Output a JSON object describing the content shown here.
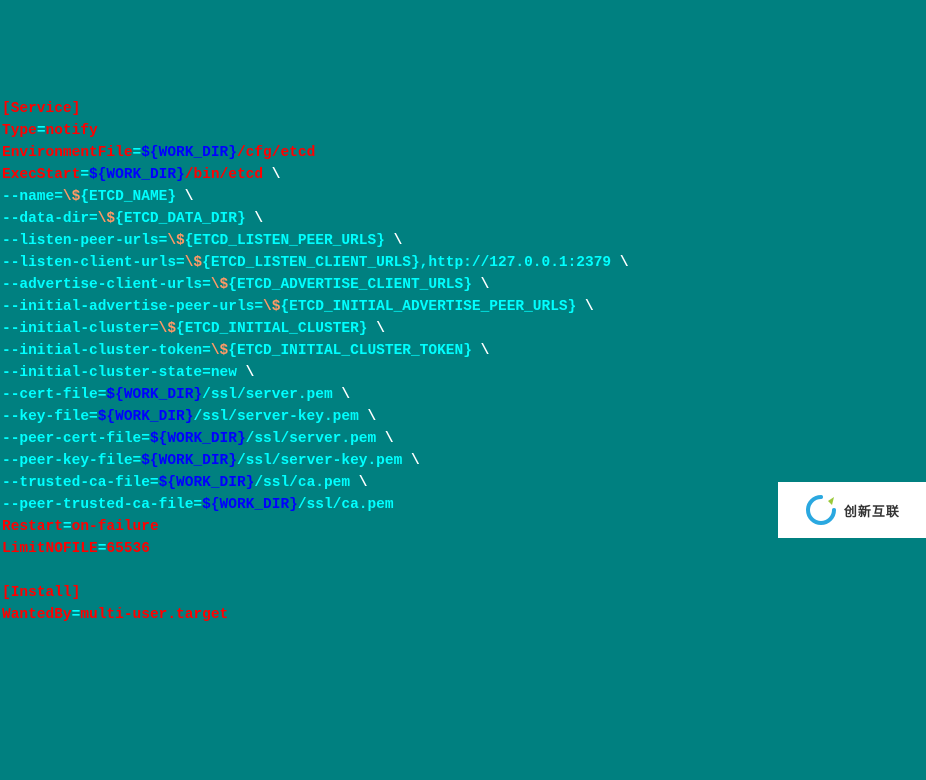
{
  "lines": [
    [
      {
        "cls": "c-red",
        "t": "[Service]"
      }
    ],
    [
      {
        "cls": "c-red",
        "t": "Type"
      },
      {
        "cls": "c-teal",
        "t": "="
      },
      {
        "cls": "c-red",
        "t": "notify"
      }
    ],
    [
      {
        "cls": "c-red",
        "t": "EnvironmentFile"
      },
      {
        "cls": "c-teal",
        "t": "="
      },
      {
        "cls": "c-blue",
        "t": "${WORK_DIR}"
      },
      {
        "cls": "c-red",
        "t": "/cfg/etcd"
      }
    ],
    [
      {
        "cls": "c-red",
        "t": "ExecStart"
      },
      {
        "cls": "c-teal",
        "t": "="
      },
      {
        "cls": "c-blue",
        "t": "${WORK_DIR}"
      },
      {
        "cls": "c-red",
        "t": "/bin/etcd "
      },
      {
        "cls": "c-white",
        "t": "\\"
      }
    ],
    [
      {
        "cls": "c-teal",
        "t": "--name="
      },
      {
        "cls": "c-peach",
        "t": "\\$"
      },
      {
        "cls": "c-teal",
        "t": "{ETCD_NAME} "
      },
      {
        "cls": "c-white",
        "t": "\\"
      }
    ],
    [
      {
        "cls": "c-teal",
        "t": "--data-dir="
      },
      {
        "cls": "c-peach",
        "t": "\\$"
      },
      {
        "cls": "c-teal",
        "t": "{ETCD_DATA_DIR} "
      },
      {
        "cls": "c-white",
        "t": "\\"
      }
    ],
    [
      {
        "cls": "c-teal",
        "t": "--listen-peer-urls="
      },
      {
        "cls": "c-peach",
        "t": "\\$"
      },
      {
        "cls": "c-teal",
        "t": "{ETCD_LISTEN_PEER_URLS} "
      },
      {
        "cls": "c-white",
        "t": "\\"
      }
    ],
    [
      {
        "cls": "c-teal",
        "t": "--listen-client-urls="
      },
      {
        "cls": "c-peach",
        "t": "\\$"
      },
      {
        "cls": "c-teal",
        "t": "{ETCD_LISTEN_CLIENT_URLS},http://127.0.0.1:2379 "
      },
      {
        "cls": "c-white",
        "t": "\\"
      }
    ],
    [
      {
        "cls": "c-teal",
        "t": "--advertise-client-urls="
      },
      {
        "cls": "c-peach",
        "t": "\\$"
      },
      {
        "cls": "c-teal",
        "t": "{ETCD_ADVERTISE_CLIENT_URLS} "
      },
      {
        "cls": "c-white",
        "t": "\\"
      }
    ],
    [
      {
        "cls": "c-teal",
        "t": "--initial-advertise-peer-urls="
      },
      {
        "cls": "c-peach",
        "t": "\\$"
      },
      {
        "cls": "c-teal",
        "t": "{ETCD_INITIAL_ADVERTISE_PEER_URLS} "
      },
      {
        "cls": "c-white",
        "t": "\\"
      }
    ],
    [
      {
        "cls": "c-teal",
        "t": "--initial-cluster="
      },
      {
        "cls": "c-peach",
        "t": "\\$"
      },
      {
        "cls": "c-teal",
        "t": "{ETCD_INITIAL_CLUSTER} "
      },
      {
        "cls": "c-white",
        "t": "\\"
      }
    ],
    [
      {
        "cls": "c-teal",
        "t": "--initial-cluster-token="
      },
      {
        "cls": "c-peach",
        "t": "\\$"
      },
      {
        "cls": "c-teal",
        "t": "{ETCD_INITIAL_CLUSTER_TOKEN} "
      },
      {
        "cls": "c-white",
        "t": "\\"
      }
    ],
    [
      {
        "cls": "c-teal",
        "t": "--initial-cluster-state=new "
      },
      {
        "cls": "c-white",
        "t": "\\"
      }
    ],
    [
      {
        "cls": "c-teal",
        "t": "--cert-file="
      },
      {
        "cls": "c-blue",
        "t": "${WORK_DIR}"
      },
      {
        "cls": "c-teal",
        "t": "/ssl/server.pem "
      },
      {
        "cls": "c-white",
        "t": "\\"
      }
    ],
    [
      {
        "cls": "c-teal",
        "t": "--key-file="
      },
      {
        "cls": "c-blue",
        "t": "${WORK_DIR}"
      },
      {
        "cls": "c-teal",
        "t": "/ssl/server-key.pem "
      },
      {
        "cls": "c-white",
        "t": "\\"
      }
    ],
    [
      {
        "cls": "c-teal",
        "t": "--peer-cert-file="
      },
      {
        "cls": "c-blue",
        "t": "${WORK_DIR}"
      },
      {
        "cls": "c-teal",
        "t": "/ssl/server.pem "
      },
      {
        "cls": "c-white",
        "t": "\\"
      }
    ],
    [
      {
        "cls": "c-teal",
        "t": "--peer-key-file="
      },
      {
        "cls": "c-blue",
        "t": "${WORK_DIR}"
      },
      {
        "cls": "c-teal",
        "t": "/ssl/server-key.pem "
      },
      {
        "cls": "c-white",
        "t": "\\"
      }
    ],
    [
      {
        "cls": "c-teal",
        "t": "--trusted-ca-file="
      },
      {
        "cls": "c-blue",
        "t": "${WORK_DIR}"
      },
      {
        "cls": "c-teal",
        "t": "/ssl/ca.pem "
      },
      {
        "cls": "c-white",
        "t": "\\"
      }
    ],
    [
      {
        "cls": "c-teal",
        "t": "--peer-trusted-ca-file="
      },
      {
        "cls": "c-blue",
        "t": "${WORK_DIR}"
      },
      {
        "cls": "c-teal",
        "t": "/ssl/ca.pem"
      }
    ],
    [
      {
        "cls": "c-red",
        "t": "Restart"
      },
      {
        "cls": "c-teal",
        "t": "="
      },
      {
        "cls": "c-red",
        "t": "on-failure"
      }
    ],
    [
      {
        "cls": "c-red",
        "t": "LimitNOFILE"
      },
      {
        "cls": "c-teal",
        "t": "="
      },
      {
        "cls": "c-red",
        "t": "65536"
      }
    ],
    [
      {
        "cls": "",
        "t": " "
      }
    ],
    [
      {
        "cls": "c-red",
        "t": "[Install]"
      }
    ],
    [
      {
        "cls": "c-red",
        "t": "WantedBy"
      },
      {
        "cls": "c-teal",
        "t": "="
      },
      {
        "cls": "c-red",
        "t": "multi-user.target"
      }
    ]
  ],
  "watermark": {
    "text": "创新互联"
  }
}
